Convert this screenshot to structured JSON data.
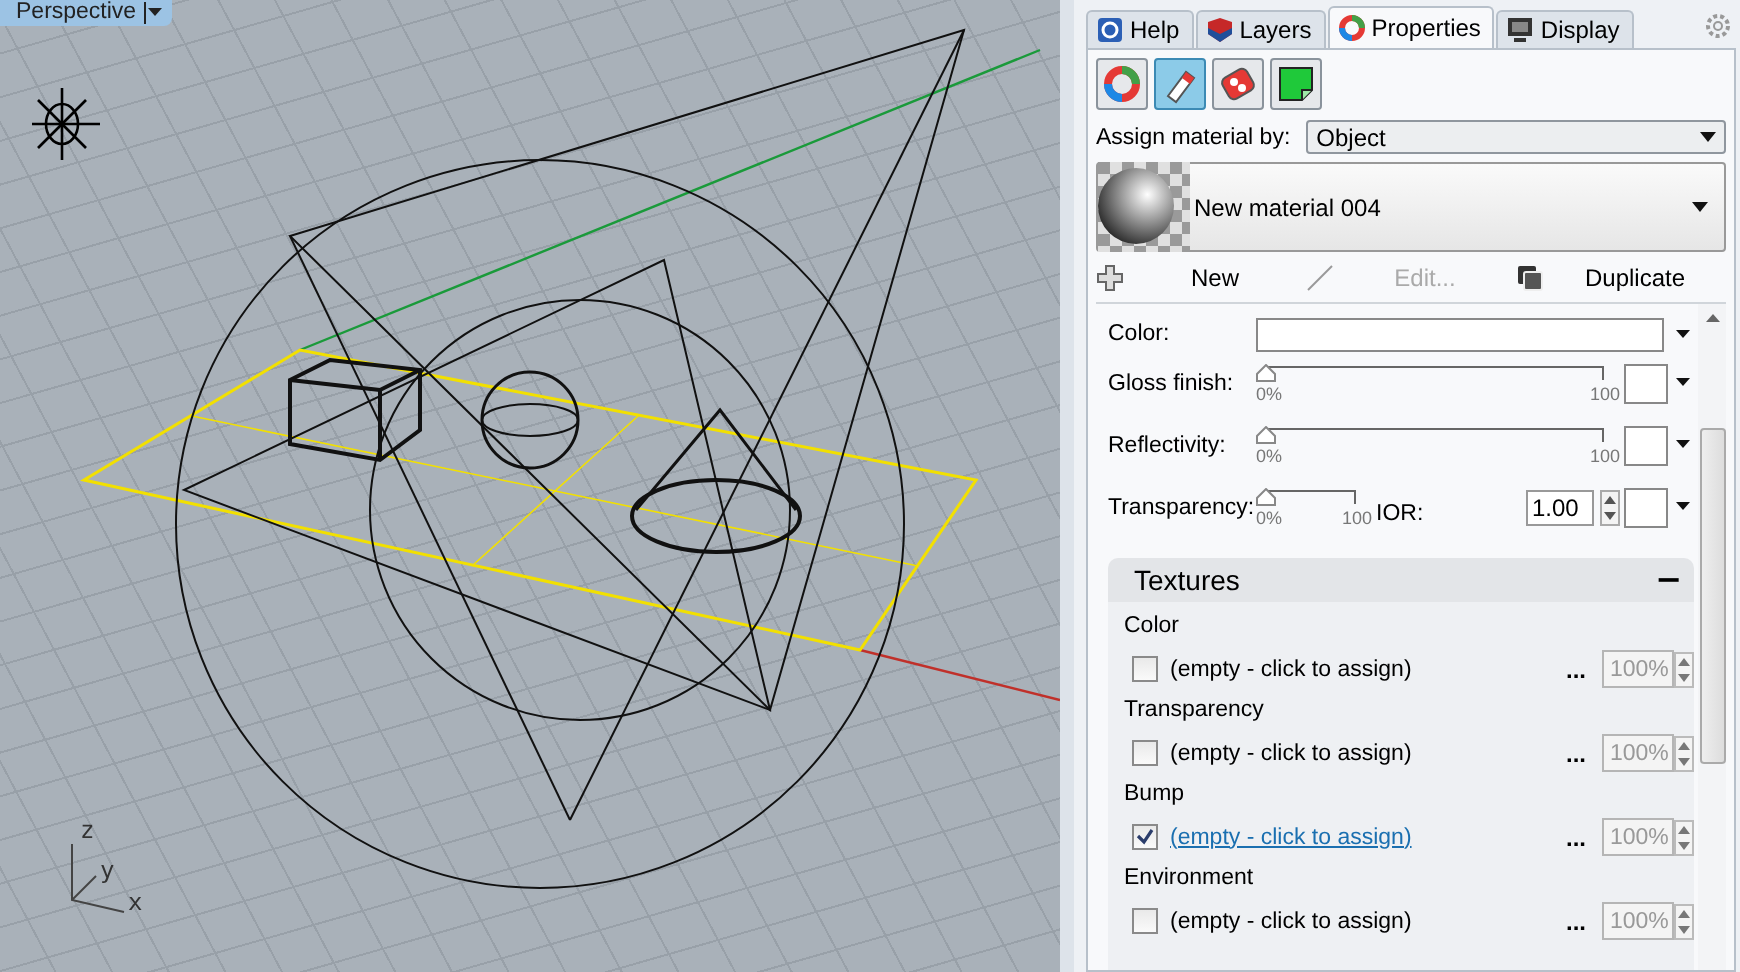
{
  "viewport": {
    "title": "Perspective",
    "axis_labels": [
      "z",
      "y",
      "x"
    ]
  },
  "panel": {
    "tabs": [
      {
        "label": "Help",
        "kind": "help",
        "selected": false
      },
      {
        "label": "Layers",
        "kind": "layers",
        "selected": false
      },
      {
        "label": "Properties",
        "kind": "properties",
        "selected": true
      },
      {
        "label": "Display",
        "kind": "display",
        "selected": false
      }
    ],
    "tool_buttons": [
      {
        "kind": "color",
        "selected": false
      },
      {
        "kind": "material",
        "selected": true
      },
      {
        "kind": "texture",
        "selected": false
      },
      {
        "kind": "decal",
        "selected": false
      }
    ],
    "assign": {
      "label": "Assign material by:",
      "value": "Object"
    },
    "material": {
      "name": "New material 004"
    },
    "actions": [
      {
        "kind": "new",
        "label": "New",
        "disabled": false
      },
      {
        "kind": "edit",
        "label": "Edit...",
        "disabled": true
      },
      {
        "kind": "duplicate",
        "label": "Duplicate",
        "disabled": false
      }
    ],
    "color": {
      "label": "Color:"
    },
    "sliders": [
      {
        "label": "Gloss finish:",
        "level": 0,
        "min": "0%",
        "max": "100"
      },
      {
        "label": "Reflectivity:",
        "level": 0,
        "min": "0%",
        "max": "100"
      },
      {
        "label": "Transparency:",
        "level": 0,
        "min": "0%",
        "max": "100",
        "ior_label": "IOR:",
        "ior": "1.00"
      }
    ],
    "textures": {
      "title": "Textures",
      "expanded": true,
      "toggle": "−",
      "items": [
        {
          "label": "Color",
          "checked": false,
          "value": "(empty - click to assign)",
          "more": "...",
          "amount": "100%"
        },
        {
          "label": "Transparency",
          "checked": false,
          "value": "(empty - click to assign)",
          "more": "...",
          "amount": "100%"
        },
        {
          "label": "Bump",
          "checked": true,
          "value": "(empty - click to assign)",
          "more": "...",
          "amount": "100%"
        },
        {
          "label": "Environment",
          "checked": false,
          "value": "(empty - click to assign)",
          "more": "...",
          "amount": "100%"
        }
      ]
    }
  }
}
